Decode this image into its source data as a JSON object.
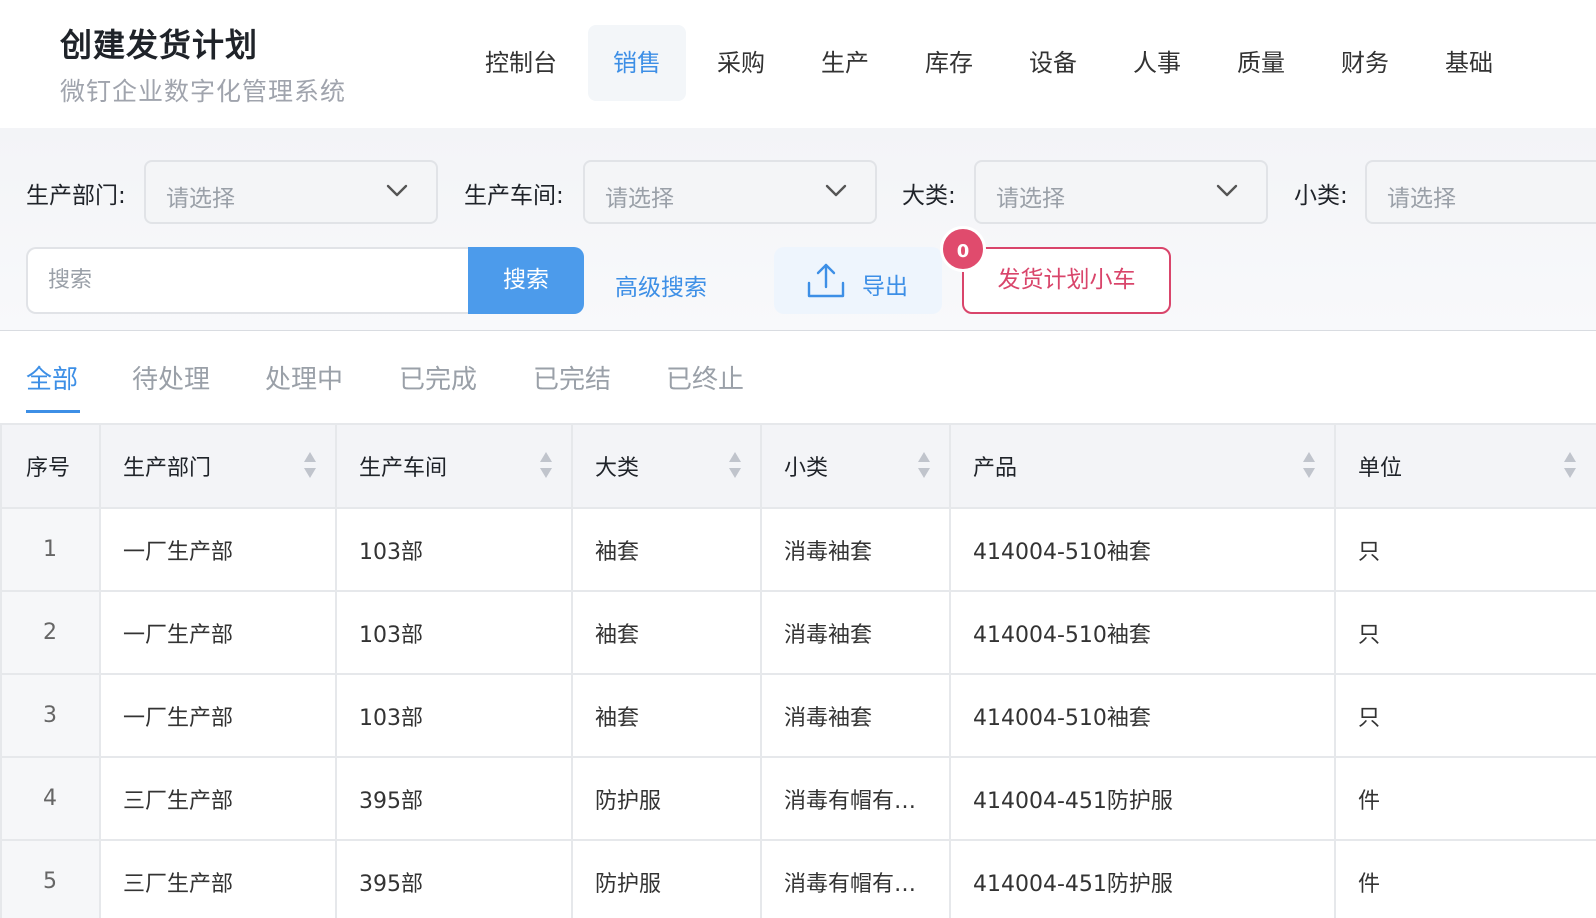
{
  "header": {
    "title": "创建发货计划",
    "subtitle": "微钉企业数字化管理系统",
    "nav": [
      "控制台",
      "销售",
      "采购",
      "生产",
      "库存",
      "设备",
      "人事",
      "质量",
      "财务",
      "基础"
    ],
    "active_nav": "销售"
  },
  "filters": {
    "dept_label": "生产部门:",
    "workshop_label": "生产车间:",
    "category_label": "大类:",
    "subcategory_label": "小类:",
    "select_placeholder": "请选择"
  },
  "search": {
    "placeholder": "搜索",
    "button": "搜索",
    "advanced": "高级搜索",
    "export": "导出",
    "cart": "发货计划小车",
    "cart_count": "0"
  },
  "tabs": [
    "全部",
    "待处理",
    "处理中",
    "已完成",
    "已完结",
    "已终止"
  ],
  "table": {
    "columns": [
      "序号",
      "生产部门",
      "生产车间",
      "大类",
      "小类",
      "产品",
      "单位"
    ],
    "rows": [
      [
        "1",
        "一厂生产部",
        "103部",
        "袖套",
        "消毒袖套",
        "414004-510袖套",
        "只"
      ],
      [
        "2",
        "一厂生产部",
        "103部",
        "袖套",
        "消毒袖套",
        "414004-510袖套",
        "只"
      ],
      [
        "3",
        "一厂生产部",
        "103部",
        "袖套",
        "消毒袖套",
        "414004-510袖套",
        "只"
      ],
      [
        "4",
        "三厂生产部",
        "395部",
        "防护服",
        "消毒有帽有…",
        "414004-451防护服",
        "件"
      ],
      [
        "5",
        "三厂生产部",
        "395部",
        "防护服",
        "消毒有帽有…",
        "414004-451防护服",
        "件"
      ]
    ]
  },
  "colors": {
    "accent": "#3d8fe6",
    "search_button": "#4c9beb",
    "cart": "#d9456b",
    "badge": "#e04b6d"
  },
  "icons": {
    "select_arrow": "chevron-down-icon",
    "export": "upload-icon",
    "sort": "sort-icon"
  }
}
